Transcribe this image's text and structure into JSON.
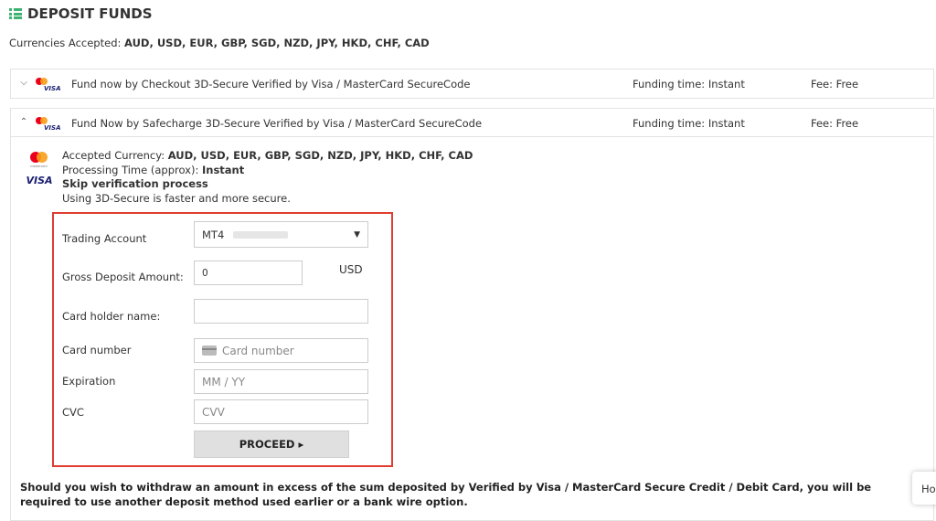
{
  "title": "DEPOSIT FUNDS",
  "currencies": {
    "label": "Currencies Accepted:",
    "value": "AUD, USD, EUR, GBP, SGD, NZD, JPY, HKD, CHF, CAD"
  },
  "panels": [
    {
      "label": "Fund now by Checkout 3D-Secure Verified by Visa / MasterCard SecureCode",
      "time": "Funding time: Instant",
      "fee": "Fee: Free",
      "expanded": false
    },
    {
      "label": "Fund Now by Safecharge 3D-Secure Verified by Visa / MasterCard SecureCode",
      "time": "Funding time: Instant",
      "fee": "Fee: Free",
      "expanded": true
    }
  ],
  "logos": {
    "visa": "VISA",
    "mc_small": "mastercard"
  },
  "info": {
    "accepted_label": "Accepted Currency:",
    "accepted_value": "AUD, USD, EUR, GBP, SGD, NZD, JPY, HKD, CHF, CAD",
    "processing_label": "Processing Time (approx):",
    "processing_value": "Instant",
    "skip": "Skip verification process",
    "faster": "Using 3D-Secure is faster and more secure."
  },
  "form": {
    "trading_account_label": "Trading Account",
    "trading_account_value": "MT4",
    "gross_label": "Gross Deposit Amount:",
    "gross_value": "0",
    "currency": "USD",
    "holder_label": "Card holder name:",
    "card_label": "Card number",
    "card_placeholder": "Card number",
    "exp_label": "Expiration",
    "exp_placeholder": "MM / YY",
    "cvc_label": "CVC",
    "cvc_placeholder": "CVV",
    "proceed": "PROCEED ▸"
  },
  "notice": "Should you wish to withdraw an amount in excess of the sum deposited by Verified by Visa / MasterCard Secure Credit / Debit Card, you will be required to use another deposit method used earlier or a bank wire option.",
  "help_tab": "Ho",
  "colors": {
    "accent_green": "#3cb371",
    "highlight_red": "#e03c31",
    "visa_blue": "#1a1f71",
    "mc_red": "#eb001b",
    "mc_orange": "#f79e1b"
  }
}
